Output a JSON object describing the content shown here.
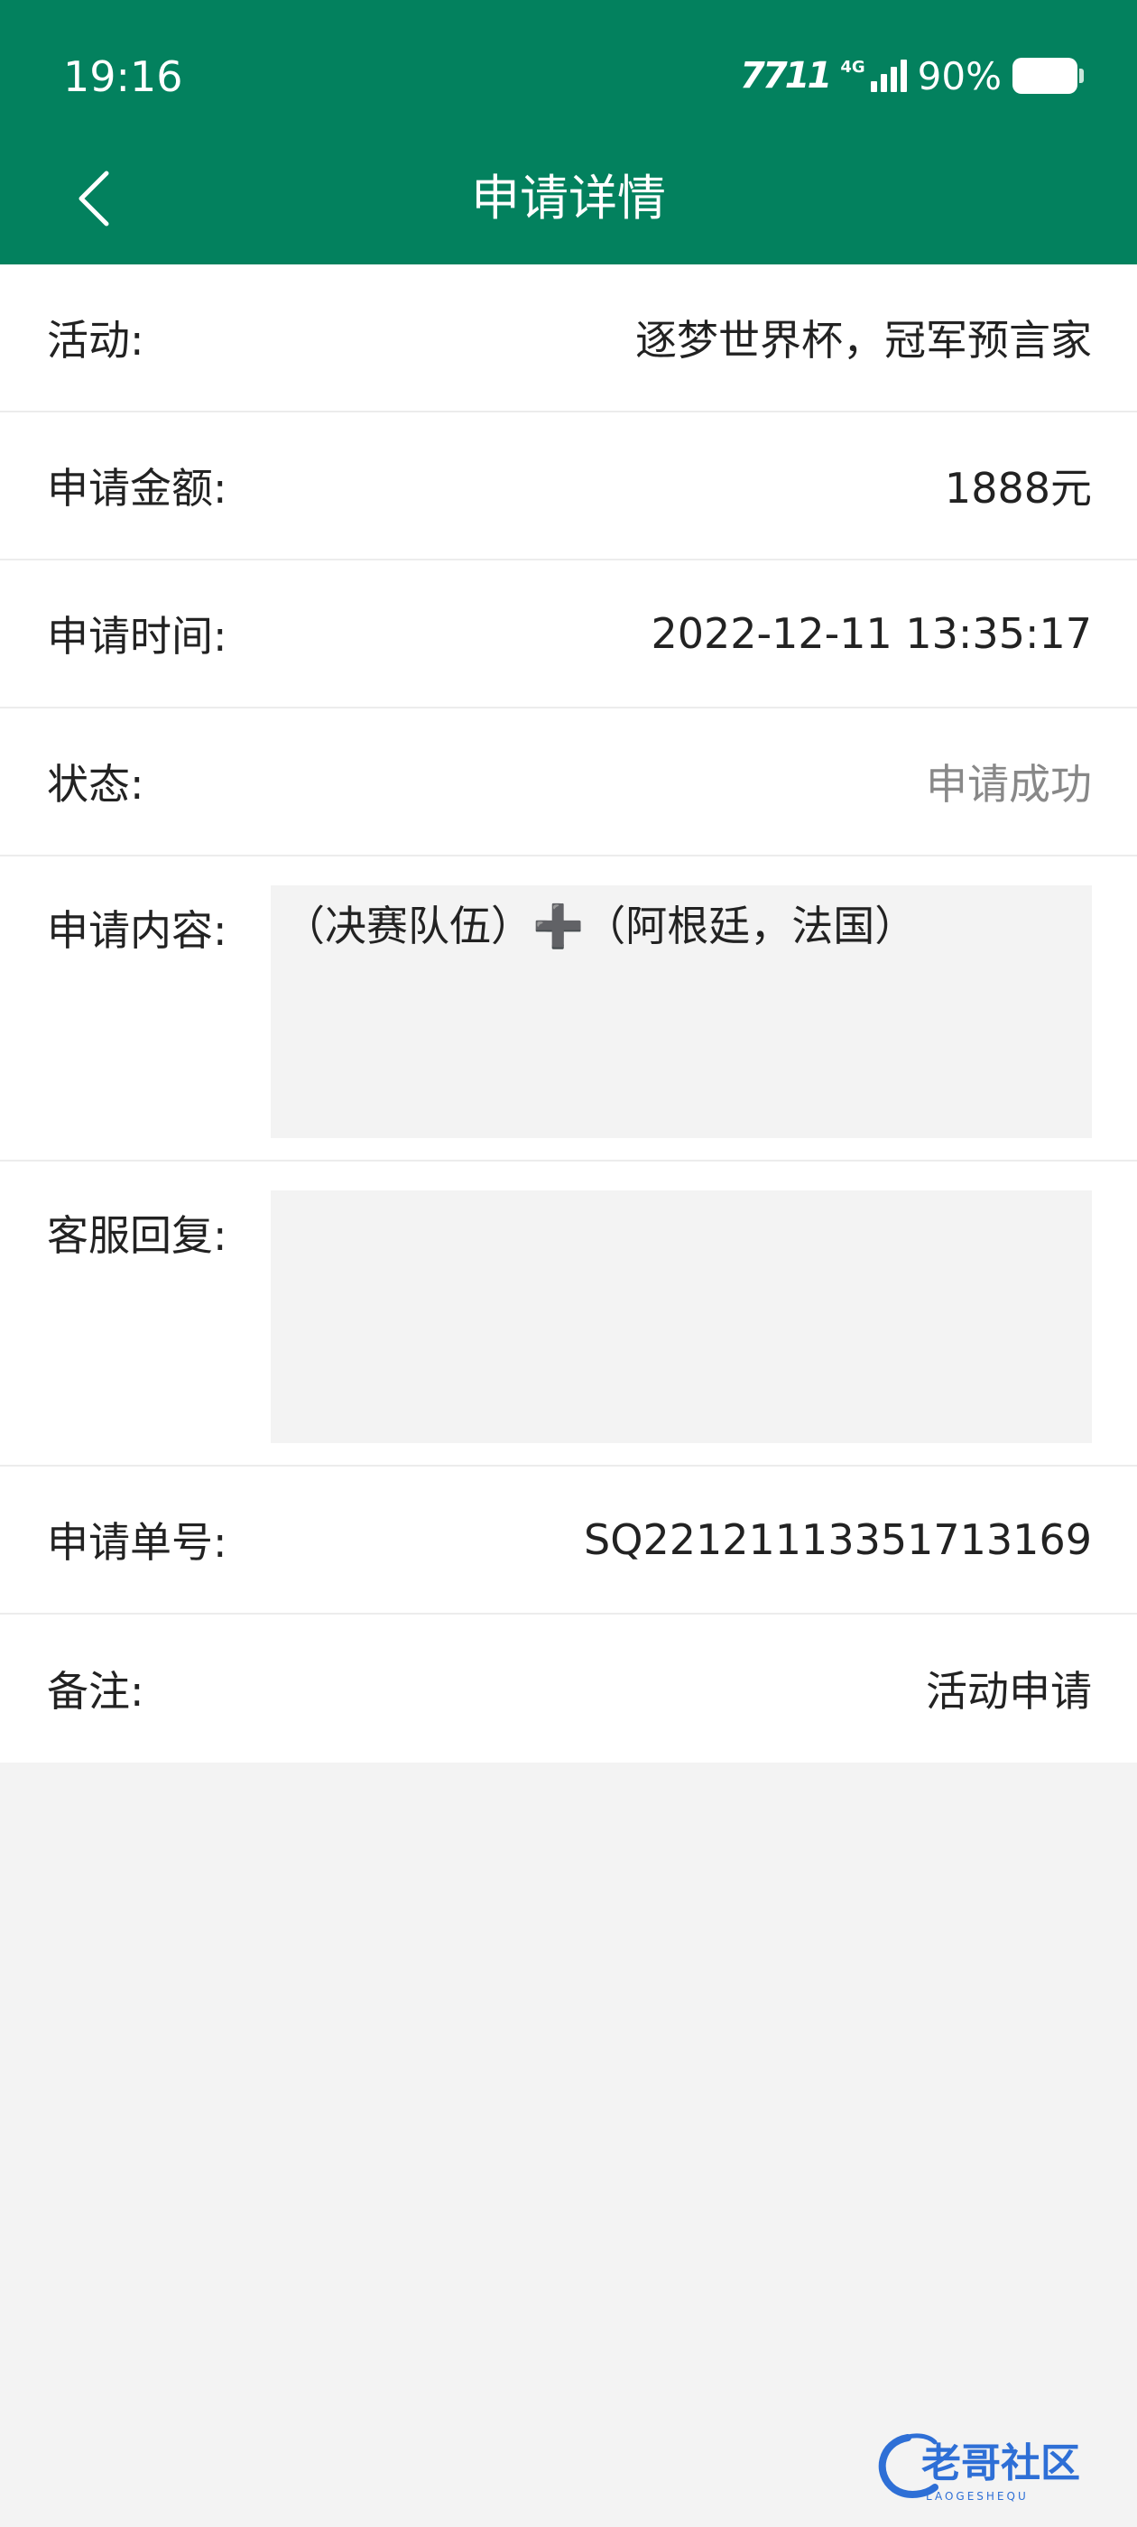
{
  "status_bar": {
    "time": "19:16",
    "network_label": "7711",
    "signal_type": "4G",
    "battery_percent": "90%"
  },
  "header": {
    "title": "申请详情",
    "background_color": "#03815e"
  },
  "details": {
    "activity_label": "活动:",
    "activity_value": "逐梦世界杯，冠军预言家",
    "amount_label": "申请金额:",
    "amount_value": "1888元",
    "time_label": "申请时间:",
    "time_value": "2022-12-11 13:35:17",
    "status_label": "状态:",
    "status_value": "申请成功",
    "content_label": "申请内容:",
    "content_value": "（决赛队伍）➕（阿根廷，法国）",
    "reply_label": "客服回复:",
    "reply_value": "",
    "order_label": "申请单号:",
    "order_value": "SQ22121113351713169",
    "remark_label": "备注:",
    "remark_value": "活动申请"
  },
  "watermark": {
    "text": "老哥社区",
    "subtext": "LAOGESHEQU"
  }
}
